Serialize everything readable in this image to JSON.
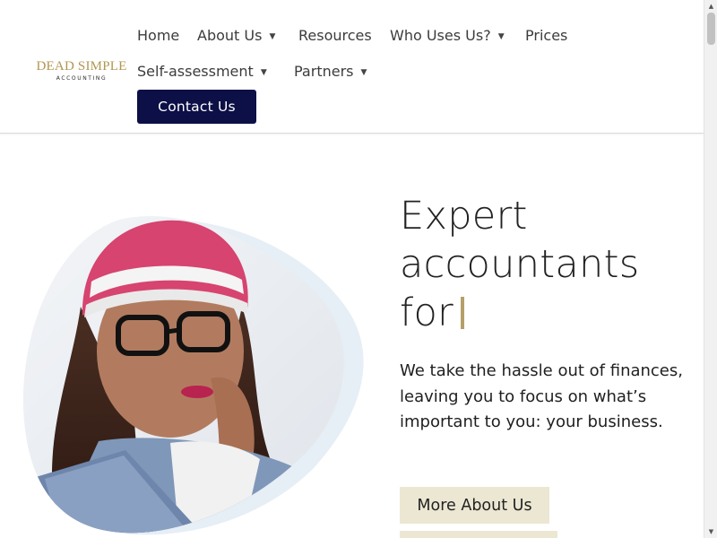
{
  "logo": {
    "main": "DEAD SIMPLE",
    "sub": "ACCOUNTING"
  },
  "nav": {
    "home": "Home",
    "about": "About Us",
    "resources": "Resources",
    "who_uses": "Who Uses Us?",
    "prices": "Prices",
    "self_assessment": "Self-assessment",
    "partners": "Partners",
    "contact": "Contact Us",
    "caret": "▲"
  },
  "hero": {
    "headline_line1": "Expert",
    "headline_line2": "accountants",
    "headline_line3": "for",
    "subtext": "We take the hassle out of finances, leaving you to focus on what’s important to you: your business.",
    "more_button": "More About Us"
  },
  "colors": {
    "accent_gold": "#b19650",
    "navy": "#0d1046",
    "beige": "#ece7d3"
  },
  "scrollbar": {
    "up": "▲",
    "down": "▼"
  }
}
